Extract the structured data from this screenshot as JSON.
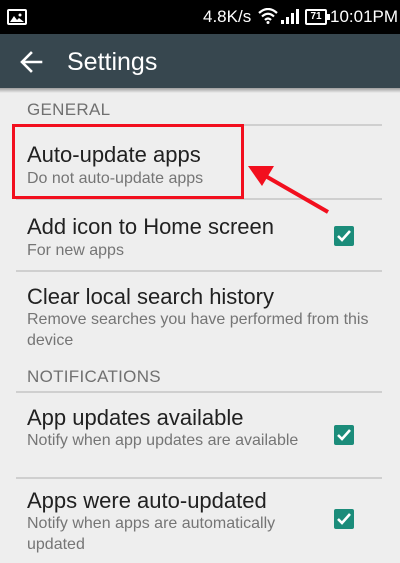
{
  "status_bar": {
    "speed": "4.8K/s",
    "battery": "71",
    "time": "10:01PM"
  },
  "toolbar": {
    "title": "Settings"
  },
  "sections": {
    "general": "GENERAL",
    "notifications": "NOTIFICATIONS"
  },
  "items": [
    {
      "title": "Auto-update apps",
      "subtitle": "Do not auto-update apps",
      "checked": null
    },
    {
      "title": "Add icon to Home screen",
      "subtitle": "For new apps",
      "checked": true
    },
    {
      "title": "Clear local search history",
      "subtitle": "Remove searches you have performed from this device",
      "checked": null
    },
    {
      "title": "App updates available",
      "subtitle": "Notify when app updates are available",
      "checked": true
    },
    {
      "title": "Apps were auto-updated",
      "subtitle": "Notify when apps are automatically updated",
      "checked": true
    }
  ],
  "colors": {
    "toolbar": "#37474f",
    "checkbox": "#1b8c7a",
    "annotation": "#f20f1e"
  }
}
